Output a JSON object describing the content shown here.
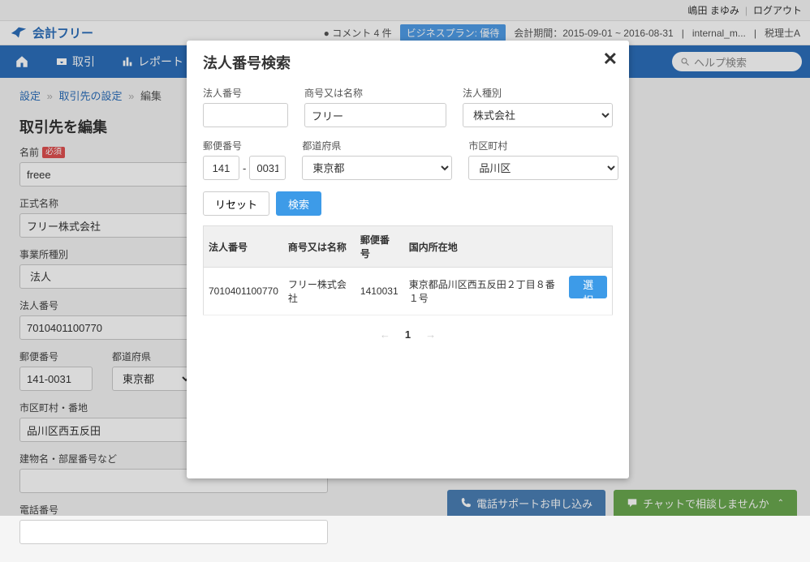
{
  "header": {
    "user_name": "嶋田 まゆみ",
    "logout": "ログアウト",
    "logo_text": "会計フリー",
    "comments": "コメント 4 件",
    "plan_badge": "ビジネスプラン: 優待",
    "period_label": "会計期間：2015-09-01 ~ 2016-08-31",
    "internal": "internal_m...",
    "accountant": "税理士A"
  },
  "nav": {
    "home": "",
    "transactions": "取引",
    "reports": "レポート",
    "search_placeholder": "ヘルプ検索"
  },
  "breadcrumb": {
    "item1": "設定",
    "item2": "取引先の設定",
    "item3": "編集"
  },
  "page": {
    "title": "取引先を編集",
    "name_label": "名前",
    "name_required": "必須",
    "name_value": "freee",
    "official_label": "正式名称",
    "official_value": "フリー株式会社",
    "biztype_label": "事業所種別",
    "biztype_value": "法人",
    "corpnum_label": "法人番号",
    "corpnum_value": "7010401100770",
    "zip_label": "郵便番号",
    "zip_value": "141-0031",
    "pref_label": "都道府県",
    "pref_value": "東京都",
    "city_label": "市区町村・番地",
    "city_value": "品川区西五反田",
    "building_label": "建物名・部屋番号など",
    "building_value": "",
    "phone_label": "電話番号",
    "phone_value": ""
  },
  "modal": {
    "title": "法人番号検索",
    "corpnum_label": "法人番号",
    "corpnum_value": "",
    "name_label": "商号又は名称",
    "name_value": "フリー",
    "type_label": "法人種別",
    "type_value": "株式会社",
    "zip_label": "郵便番号",
    "zip1": "141",
    "zip2": "0031",
    "zip_sep": "-",
    "pref_label": "都道府県",
    "pref_value": "東京都",
    "city_label": "市区町村",
    "city_value": "品川区",
    "reset_btn": "リセット",
    "search_btn": "検索",
    "col_corpnum": "法人番号",
    "col_name": "商号又は名称",
    "col_zip": "郵便番号",
    "col_addr": "国内所在地",
    "row": {
      "corpnum": "7010401100770",
      "name": "フリー株式会社",
      "zip": "1410031",
      "addr": "東京都品川区西五反田２丁目８番１号",
      "select": "選択"
    },
    "page_current": "1"
  },
  "cta": {
    "phone": "電話サポートお申し込み",
    "chat": "チャットで相談しませんか"
  }
}
